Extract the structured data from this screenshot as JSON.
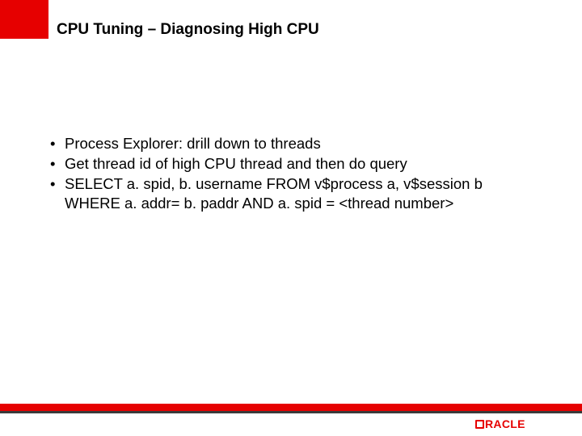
{
  "slide": {
    "title": "CPU Tuning – Diagnosing High CPU",
    "bullets": [
      "Process Explorer: drill down to threads",
      "Get thread id of high CPU thread and then do query",
      "SELECT a. spid, b. username FROM v$process a, v$session b WHERE a. addr= b. paddr AND a. spid = <thread number>"
    ],
    "footer": {
      "logo_text": "ORACLE"
    }
  },
  "colors": {
    "accent": "#e60000",
    "dark": "#3a3a3a"
  }
}
